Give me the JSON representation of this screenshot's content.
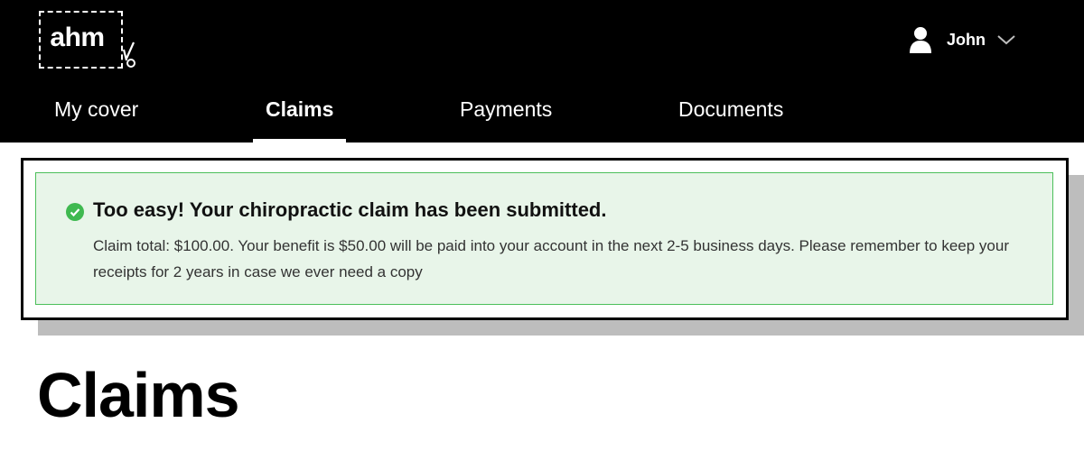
{
  "header": {
    "logo_text": "ahm",
    "user": {
      "name": "John"
    },
    "tabs": [
      {
        "label": "My cover",
        "active": false
      },
      {
        "label": "Claims",
        "active": true
      },
      {
        "label": "Payments",
        "active": false
      },
      {
        "label": "Documents",
        "active": false
      }
    ]
  },
  "notification": {
    "icon": "check-circle-icon",
    "title": "Too easy! Your chiropractic claim has been submitted.",
    "message": "Claim total: $100.00. Your benefit is $50.00 will be paid into your account in the next 2-5 business days. Please remember to keep your receipts for 2 years in case we ever need a copy"
  },
  "page": {
    "title": "Claims"
  },
  "colors": {
    "header_bg": "#000000",
    "success_bg": "#e8f5e9",
    "success_border": "#4cbf5a",
    "success_icon": "#3fb950"
  }
}
